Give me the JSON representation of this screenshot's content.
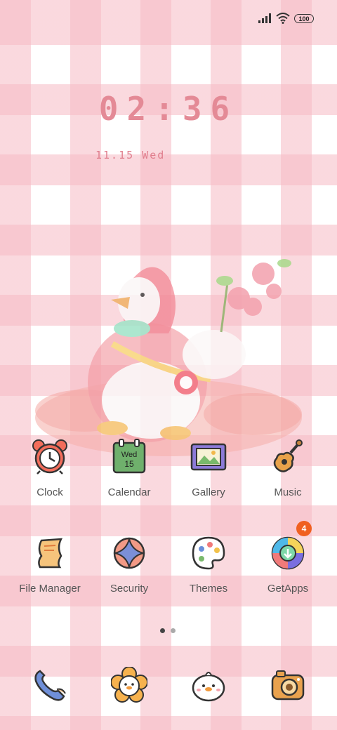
{
  "status_bar": {
    "battery": "100",
    "signal_icon": "signal-bars-icon",
    "wifi_icon": "wifi-icon"
  },
  "lock_clock": {
    "time": "02:36",
    "date": "11.15 Wed"
  },
  "home_row1": [
    {
      "label": "Clock",
      "icon": "alarm-clock-icon"
    },
    {
      "label": "Calendar",
      "icon": "calendar-icon",
      "day_name": "Wed",
      "day_num": "15"
    },
    {
      "label": "Gallery",
      "icon": "picture-frame-icon"
    },
    {
      "label": "Music",
      "icon": "guitar-icon"
    }
  ],
  "home_row2": [
    {
      "label": "File Manager",
      "icon": "scroll-icon"
    },
    {
      "label": "Security",
      "icon": "shield-star-icon"
    },
    {
      "label": "Themes",
      "icon": "palette-icon"
    },
    {
      "label": "GetApps",
      "icon": "getapps-icon",
      "badge": "4"
    }
  ],
  "dock": [
    {
      "icon": "phone-icon"
    },
    {
      "icon": "flower-duck-icon"
    },
    {
      "icon": "duck-face-icon"
    },
    {
      "icon": "camera-icon"
    }
  ],
  "page_indicator": {
    "pages": 2,
    "current": 1
  },
  "colors": {
    "accent": "#e48a96",
    "badge": "#f06020",
    "plaid": "#f6bac4"
  }
}
